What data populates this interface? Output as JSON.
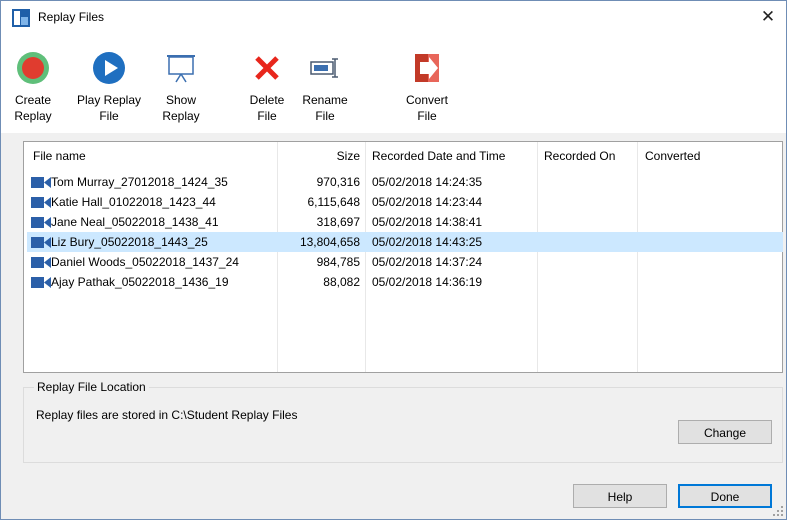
{
  "window": {
    "title": "Replay Files",
    "close_glyph": "✕"
  },
  "toolbar": {
    "create": {
      "line1": "Create",
      "line2": "Replay",
      "icon": "record-icon"
    },
    "play": {
      "line1": "Play Replay",
      "line2": "File",
      "icon": "play-icon"
    },
    "show": {
      "line1": "Show",
      "line2": "Replay",
      "icon": "presentation-screen-icon"
    },
    "delete": {
      "line1": "Delete",
      "line2": "File",
      "icon": "delete-x-icon"
    },
    "rename": {
      "line1": "Rename",
      "line2": "File",
      "icon": "rename-icon"
    },
    "convert": {
      "line1": "Convert",
      "line2": "File",
      "icon": "convert-icon"
    }
  },
  "table": {
    "columns": [
      "File name",
      "Size",
      "Recorded Date and Time",
      "Recorded On",
      "Converted"
    ],
    "rows": [
      {
        "name": "Tom Murray_27012018_1424_35",
        "size": "970,316",
        "date": "05/02/2018 14:24:35",
        "on": "",
        "converted": ""
      },
      {
        "name": "Katie Hall_01022018_1423_44",
        "size": "6,115,648",
        "date": "05/02/2018 14:23:44",
        "on": "",
        "converted": ""
      },
      {
        "name": "Jane Neal_05022018_1438_41",
        "size": "318,697",
        "date": "05/02/2018 14:38:41",
        "on": "",
        "converted": ""
      },
      {
        "name": "Liz Bury_05022018_1443_25",
        "size": "13,804,658",
        "date": "05/02/2018 14:43:25",
        "on": "",
        "converted": ""
      },
      {
        "name": "Daniel Woods_05022018_1437_24",
        "size": "984,785",
        "date": "05/02/2018 14:37:24",
        "on": "",
        "converted": ""
      },
      {
        "name": "Ajay Pathak_05022018_1436_19",
        "size": "88,082",
        "date": "05/02/2018 14:36:19",
        "on": "",
        "converted": ""
      }
    ],
    "selected_row": "Liz Bury_05022018_1443_25"
  },
  "location": {
    "title": "Replay File Location",
    "text": "Replay files are stored in C:\\Student Replay Files",
    "change_label": "Change"
  },
  "footer": {
    "help_label": "Help",
    "done_label": "Done"
  },
  "colors": {
    "selection": "#cce8ff",
    "record": "#e03c2f",
    "play": "#1f6fc0",
    "delete": "#e8261c",
    "convert": "#d9432c",
    "default_border": "#0078d7"
  }
}
